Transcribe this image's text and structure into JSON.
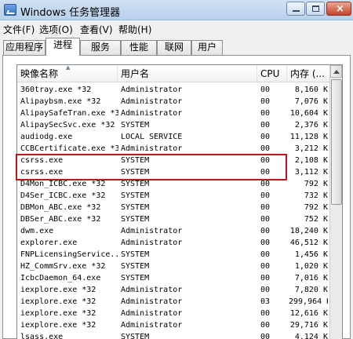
{
  "window": {
    "title": "Windows 任务管理器"
  },
  "menu": [
    "文件(F)",
    "选项(O)",
    "查看(V)",
    "帮助(H)"
  ],
  "tabs": [
    {
      "label": "应用程序",
      "active": false
    },
    {
      "label": "进程",
      "active": true
    },
    {
      "label": "服务",
      "active": false
    },
    {
      "label": "性能",
      "active": false
    },
    {
      "label": "联网",
      "active": false
    },
    {
      "label": "用户",
      "active": false
    }
  ],
  "columns": {
    "name": "映像名称",
    "user": "用户名",
    "cpu": "CPU",
    "mem": "内存 (..."
  },
  "processes": [
    [
      "360tray.exe *32",
      "Administrator",
      "00",
      "8,160 K"
    ],
    [
      "Alipaybsm.exe *32",
      "Administrator",
      "00",
      "7,076 K"
    ],
    [
      "AlipaySafeTran.exe *32",
      "Administrator",
      "00",
      "10,604 K"
    ],
    [
      "AlipaySecSvc.exe *32",
      "SYSTEM",
      "00",
      "2,376 K"
    ],
    [
      "audiodg.exe",
      "LOCAL SERVICE",
      "00",
      "11,128 K"
    ],
    [
      "CCBCertificate.exe *32",
      "Administrator",
      "00",
      "3,212 K"
    ],
    [
      "csrss.exe",
      "SYSTEM",
      "00",
      "2,108 K"
    ],
    [
      "csrss.exe",
      "SYSTEM",
      "00",
      "3,112 K"
    ],
    [
      "D4Mon_ICBC.exe *32",
      "SYSTEM",
      "00",
      "792 K"
    ],
    [
      "D4Ser_ICBC.exe *32",
      "SYSTEM",
      "00",
      "732 K"
    ],
    [
      "DBMon_ABC.exe *32",
      "SYSTEM",
      "00",
      "792 K"
    ],
    [
      "DBSer_ABC.exe *32",
      "SYSTEM",
      "00",
      "752 K"
    ],
    [
      "dwm.exe",
      "Administrator",
      "00",
      "18,240 K"
    ],
    [
      "explorer.exe",
      "Administrator",
      "00",
      "46,512 K"
    ],
    [
      "FNPLicensingService...",
      "SYSTEM",
      "00",
      "1,456 K"
    ],
    [
      "HZ_CommSrv.exe *32",
      "SYSTEM",
      "00",
      "1,020 K"
    ],
    [
      "IcbcDaemon_64.exe",
      "SYSTEM",
      "00",
      "7,016 K"
    ],
    [
      "iexplore.exe *32",
      "Administrator",
      "00",
      "7,820 K"
    ],
    [
      "iexplore.exe *32",
      "Administrator",
      "03",
      "299,964 K"
    ],
    [
      "iexplore.exe *32",
      "Administrator",
      "00",
      "12,616 K"
    ],
    [
      "iexplore.exe *32",
      "Administrator",
      "00",
      "29,716 K"
    ],
    [
      "lsass.exe",
      "SYSTEM",
      "00",
      "4,124 K"
    ]
  ],
  "colors": {
    "highlight_border": "#c0161d",
    "titlebar": "#bcd3ea"
  },
  "icons": {
    "app": "task-manager-icon",
    "sort": "sort-up-icon"
  }
}
